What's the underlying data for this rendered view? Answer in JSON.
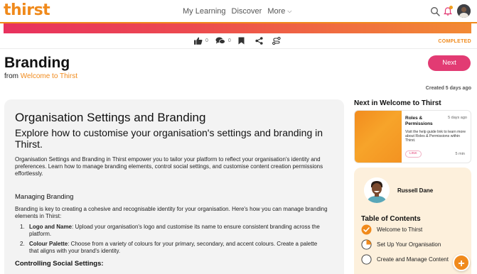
{
  "header": {
    "logo": "thirst",
    "nav": [
      {
        "label": "My Learning"
      },
      {
        "label": "Discover"
      },
      {
        "label": "More"
      }
    ],
    "icons": {
      "search": "search-icon",
      "notifications": "bell-icon",
      "profile": "avatar"
    }
  },
  "actions": {
    "like_count": "0",
    "comment_count": "0",
    "status": "COMPLETED"
  },
  "page": {
    "title": "Branding",
    "from_prefix": "from",
    "from_link": "Welcome to Thirst",
    "next_label": "Next",
    "created": "Created 5 days ago"
  },
  "content": {
    "heading": "Organisation Settings and Branding",
    "subheading": "Explore how to customise your organisation's settings and branding in Thirst.",
    "intro": "Organisation Settings and Branding in Thirst empower you to tailor your platform to reflect your organisation's identity and preferences. Learn how to manage branding elements, control social settings, and customise content creation permissions effortlessly.",
    "section1_title": "Managing Branding",
    "section1_text": "Branding is key to creating a cohesive and recognisable identity for your organisation. Here's how you can manage branding elements in Thirst:",
    "list": [
      {
        "num": "1.",
        "bold": "Logo and Name",
        "text": ": Upload your organisation's logo and customise its name to ensure consistent branding across the platform."
      },
      {
        "num": "2.",
        "bold": "Colour Palette",
        "text": ": Choose from a variety of colours for your primary, secondary, and accent colours. Create a palette that aligns with your brand's identity."
      }
    ],
    "section2_title": "Controlling Social Settings:"
  },
  "sidebar": {
    "next_heading": "Next in Welcome to Thirst",
    "next_card": {
      "title": "Roles & Permissions",
      "time": "5 days ago",
      "description": "Visit the help guide link to learn more about Roles & Permissions within Thirst.",
      "badge": "LINK",
      "duration": "5 min"
    },
    "toc": {
      "author": "Russell Dane",
      "heading": "Table of Contents",
      "items": [
        {
          "label": "Welcome to Thirst",
          "state": "complete"
        },
        {
          "label": "Set Up Your Organisation",
          "state": "partial"
        },
        {
          "label": "Create and Manage Content",
          "state": "empty"
        }
      ]
    }
  },
  "colors": {
    "brand_orange": "#f08a1c",
    "accent_pink": "#e23b73"
  }
}
